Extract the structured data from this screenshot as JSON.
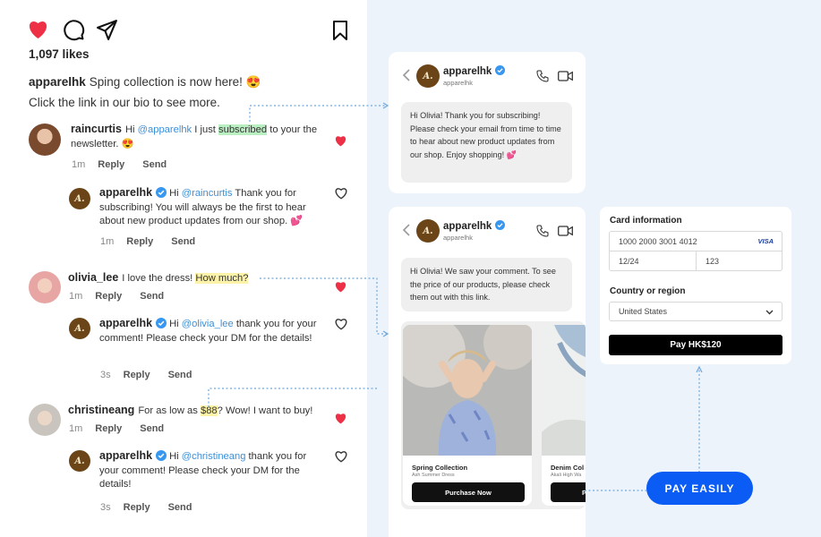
{
  "post": {
    "likes": "1,097 likes",
    "username": "apparelhk",
    "caption_line1": "Sping collection is now here! 😍",
    "caption_line2": "Click the link in our bio to see more."
  },
  "comments": [
    {
      "user": "raincurtis",
      "pre": "Hi ",
      "mention": "@apparelhk",
      "mid": " I just ",
      "highlight": "subscribed",
      "post": " to your the newsletter. 😍",
      "time": "1m",
      "reply": "Reply",
      "send": "Send",
      "reply_item": {
        "user": "apparelhk",
        "pre": "Hi ",
        "mention": "@raincurtis",
        "text": " Thank you for subscribing! You will always be the first to hear about new product updates from our shop. 💕",
        "time": "1m",
        "reply": "Reply",
        "send": "Send"
      }
    },
    {
      "user": "olivia_lee",
      "pre": "I love the dress! ",
      "highlight": "How much?",
      "time": "1m",
      "reply": "Reply",
      "send": "Send",
      "reply_item": {
        "user": "apparelhk",
        "pre": "Hi ",
        "mention": "@olivia_lee",
        "text": " thank you for your comment! Please check your DM for the details!",
        "time": "3s",
        "reply": "Reply",
        "send": "Send"
      }
    },
    {
      "user": "christineang",
      "pre": "For as low as ",
      "highlight": "$88",
      "post": "? Wow! I want to buy!",
      "time": "1m",
      "reply": "Reply",
      "send": "Send",
      "reply_item": {
        "user": "apparelhk",
        "pre": "Hi ",
        "mention": "@christineang",
        "text": " thank you for your comment! Please check your DM for the details!",
        "time": "3s",
        "reply": "Reply",
        "send": "Send"
      }
    }
  ],
  "dm1": {
    "name": "apparelhk",
    "handle": "apparelhk",
    "message": "Hi Olivia! Thank you for subscribing! Please check your email from time to time to hear about new product updates from our shop. Enjoy shopping! 💕"
  },
  "dm2": {
    "name": "apparelhk",
    "handle": "apparelhk",
    "message": "Hi Olivia! We saw your comment. To see the price of our products, please check them out with this link.",
    "products": [
      {
        "title": "Spring Collection",
        "subtitle": "Ash Summer Dress",
        "button": "Purchase Now"
      },
      {
        "title": "Denim Col",
        "subtitle": "Akali High Wa",
        "button": "P"
      }
    ]
  },
  "checkout": {
    "card_label": "Card information",
    "card_number": "1000 2000 3001 4012",
    "card_brand": "VISA",
    "expiry": "12/24",
    "cvc": "123",
    "country_label": "Country or region",
    "country": "United States",
    "pay_button": "Pay HK$120"
  },
  "cta": "PAY EASILY",
  "avatar_letter": "A.",
  "colors": {
    "heart_red": "#ee3047",
    "mention_blue": "#3d8fd6",
    "verified_blue": "#3897f0",
    "pay_easily_blue": "#0a5cf5",
    "highlight_green": "#b9efc1",
    "highlight_yellow": "#fdf3a8",
    "brand_brown": "#6b4518"
  }
}
